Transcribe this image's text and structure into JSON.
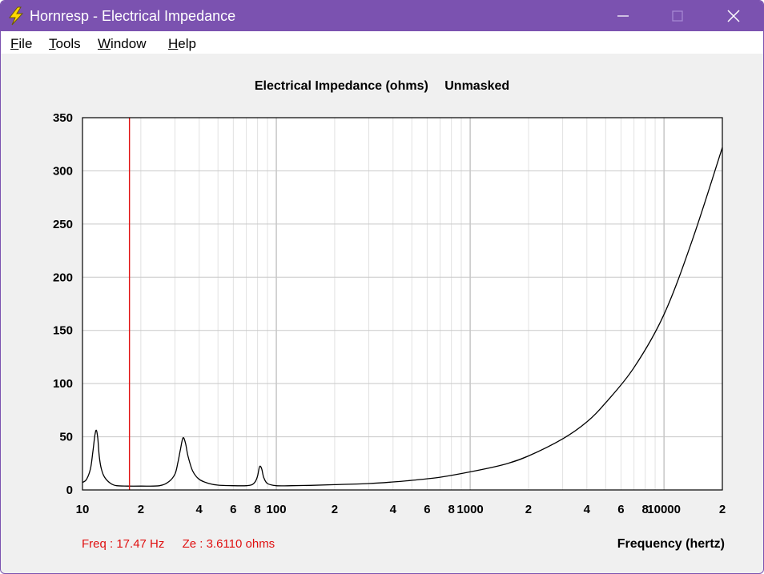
{
  "window": {
    "title": "Hornresp - Electrical Impedance",
    "icon": "lightning-icon",
    "controls": [
      "minimize-icon",
      "maximize-icon",
      "close-icon"
    ]
  },
  "menu": [
    {
      "label": "File",
      "mnemonic": "F",
      "rest": "ile"
    },
    {
      "label": "Tools",
      "mnemonic": "T",
      "rest": "ools"
    },
    {
      "label": "Window",
      "mnemonic": "W",
      "rest": "indow"
    },
    {
      "label": "Help",
      "mnemonic": "H",
      "rest": "elp"
    }
  ],
  "readout": {
    "freq": "Freq : 17.47 Hz",
    "ze": "Ze : 3.6110 ohms"
  },
  "colors": {
    "titlebar": "#7b52b0",
    "curve": "#000000",
    "cursor": "#e01010",
    "grid": "#c8c8c8"
  },
  "chart_data": {
    "type": "line",
    "title": "Electrical Impedance (ohms)",
    "subtitle": "Unmasked",
    "xlabel": "Frequency (hertz)",
    "ylabel": "",
    "xscale": "log",
    "xlim": [
      10,
      20000
    ],
    "ylim": [
      0,
      350
    ],
    "grid": true,
    "yticks": [
      0,
      50,
      100,
      150,
      200,
      250,
      300,
      350
    ],
    "xticks": [
      {
        "value": 10,
        "label": "10"
      },
      {
        "value": 20,
        "label": "2"
      },
      {
        "value": 40,
        "label": "4"
      },
      {
        "value": 60,
        "label": "6"
      },
      {
        "value": 80,
        "label": "8"
      },
      {
        "value": 100,
        "label": "100"
      },
      {
        "value": 200,
        "label": "2"
      },
      {
        "value": 400,
        "label": "4"
      },
      {
        "value": 600,
        "label": "6"
      },
      {
        "value": 800,
        "label": "8"
      },
      {
        "value": 1000,
        "label": "1000"
      },
      {
        "value": 2000,
        "label": "2"
      },
      {
        "value": 4000,
        "label": "4"
      },
      {
        "value": 6000,
        "label": "6"
      },
      {
        "value": 8000,
        "label": "8"
      },
      {
        "value": 10000,
        "label": "10000"
      },
      {
        "value": 20000,
        "label": "2"
      }
    ],
    "cursor_x": 17.47,
    "series": [
      {
        "x": [
          10,
          10.5,
          11,
          11.3,
          11.6,
          11.8,
          12.0,
          12.2,
          12.5,
          13,
          14,
          15,
          17,
          20,
          25,
          28,
          30,
          31,
          32,
          33,
          34,
          35,
          37,
          40,
          45,
          50,
          60,
          70,
          75,
          78,
          80,
          82,
          84,
          86,
          90,
          100,
          120,
          150,
          200,
          300,
          400,
          500,
          700,
          1000,
          1500,
          2000,
          3000,
          4000,
          5000,
          7000,
          10000,
          14000,
          20000
        ],
        "y": [
          7,
          10,
          20,
          35,
          52,
          56,
          48,
          32,
          20,
          12,
          6,
          4,
          3.6,
          3.6,
          4,
          8,
          15,
          25,
          38,
          49,
          44,
          32,
          18,
          10,
          6,
          4.5,
          4,
          4,
          5,
          8,
          13,
          22,
          20,
          12,
          6,
          4,
          4,
          4.3,
          5,
          6,
          7.5,
          9,
          12,
          17,
          24,
          32,
          48,
          64,
          82,
          115,
          165,
          235,
          322
        ]
      }
    ]
  }
}
